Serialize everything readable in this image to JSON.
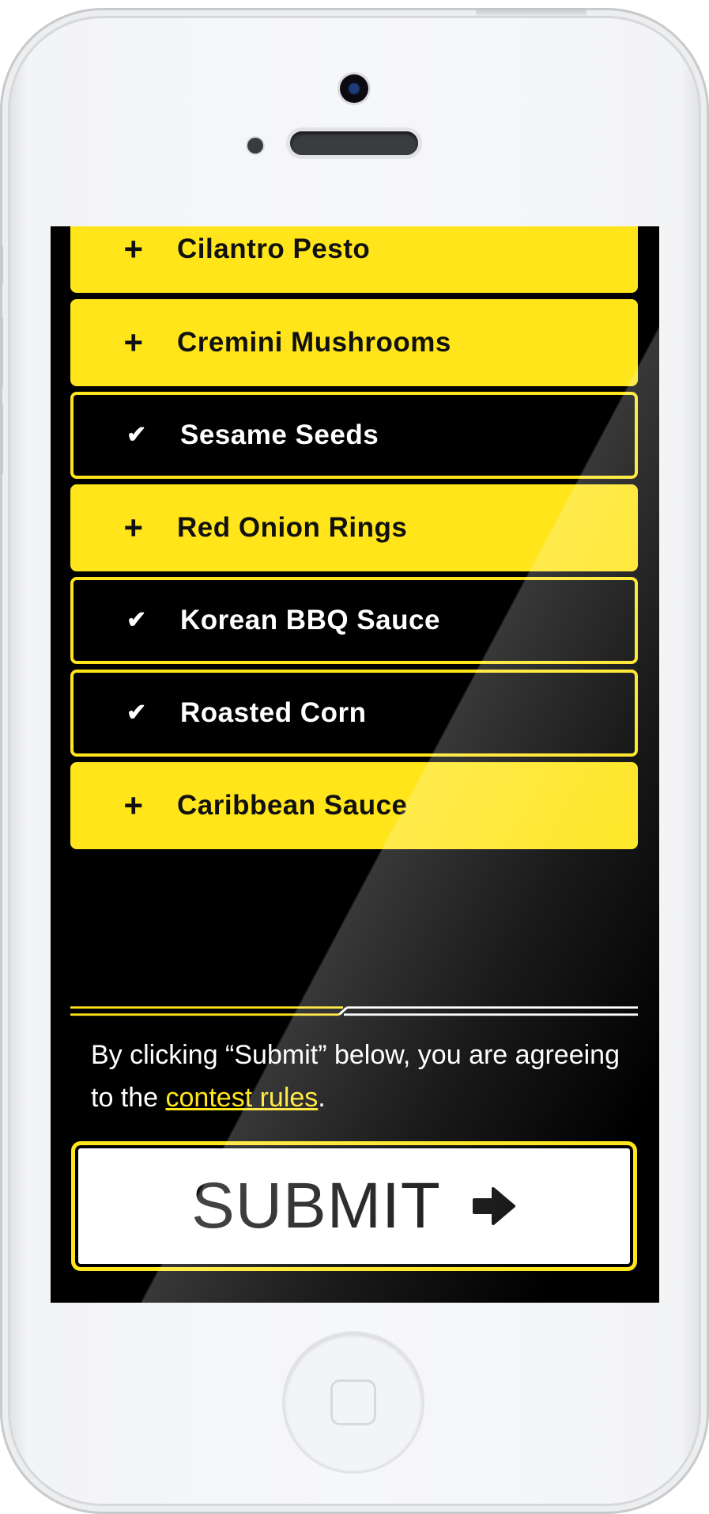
{
  "options": [
    {
      "label": "Cilantro Pesto",
      "state": "add",
      "icon": "plus-icon",
      "glyph": "+"
    },
    {
      "label": "Cremini Mushrooms",
      "state": "add",
      "icon": "plus-icon",
      "glyph": "+"
    },
    {
      "label": "Sesame Seeds",
      "state": "selected",
      "icon": "check-icon",
      "glyph": "✔"
    },
    {
      "label": "Red Onion Rings",
      "state": "add",
      "icon": "plus-icon",
      "glyph": "+"
    },
    {
      "label": "Korean BBQ Sauce",
      "state": "selected",
      "icon": "check-icon",
      "glyph": "✔"
    },
    {
      "label": "Roasted Corn",
      "state": "selected",
      "icon": "check-icon",
      "glyph": "✔"
    },
    {
      "label": "Caribbean Sauce",
      "state": "add",
      "icon": "plus-icon",
      "glyph": "+"
    }
  ],
  "disclaimer": {
    "before": "By clicking “Submit” below, you are agreeing to the ",
    "link": "contest rules",
    "after": "."
  },
  "submit": {
    "label": "SUBMIT",
    "icon": "arrow-right-icon"
  },
  "colors": {
    "accent": "#ffe51a",
    "screen_background": "#000000",
    "button_background": "#ffffff"
  }
}
